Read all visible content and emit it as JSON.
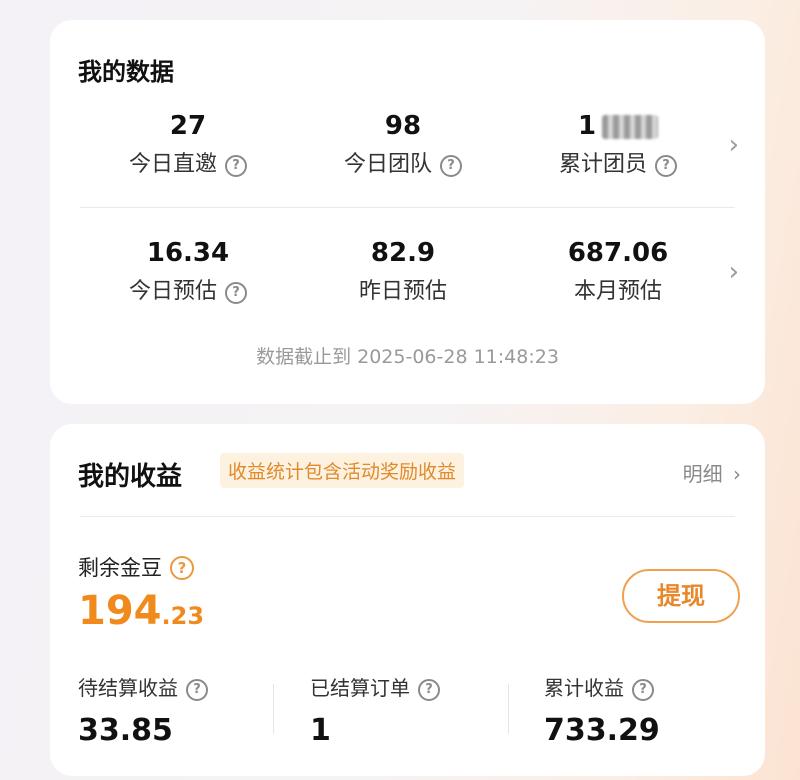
{
  "my_data": {
    "title": "我的数据",
    "row1": [
      {
        "value": "27",
        "label": "今日直邀",
        "help": true
      },
      {
        "value": "98",
        "label": "今日团队",
        "help": true
      },
      {
        "value": "1",
        "label": "累计团员",
        "help": true,
        "blurred": true
      }
    ],
    "row2": [
      {
        "value": "16.34",
        "label": "今日预估",
        "help": true
      },
      {
        "value": "82.9",
        "label": "昨日预估",
        "help": false
      },
      {
        "value": "687.06",
        "label": "本月预估",
        "help": false
      }
    ],
    "timestamp": "数据截止到 2025-06-28 11:48:23"
  },
  "my_earnings": {
    "title": "我的收益",
    "tag": "收益统计包含活动奖励收益",
    "detail": "明细",
    "balance_label": "剩余金豆",
    "balance_int": "194",
    "balance_dec": ".23",
    "withdraw_label": "提现",
    "stats": [
      {
        "label": "待结算收益",
        "value": "33.85"
      },
      {
        "label": "已结算订单",
        "value": "1"
      },
      {
        "label": "累计收益",
        "value": "733.29"
      }
    ]
  },
  "icons": {
    "help": "?",
    "chevron": "›"
  },
  "colors": {
    "accent": "#f08a1c",
    "tag_bg": "#fdf2e0",
    "card": "#ffffff"
  }
}
